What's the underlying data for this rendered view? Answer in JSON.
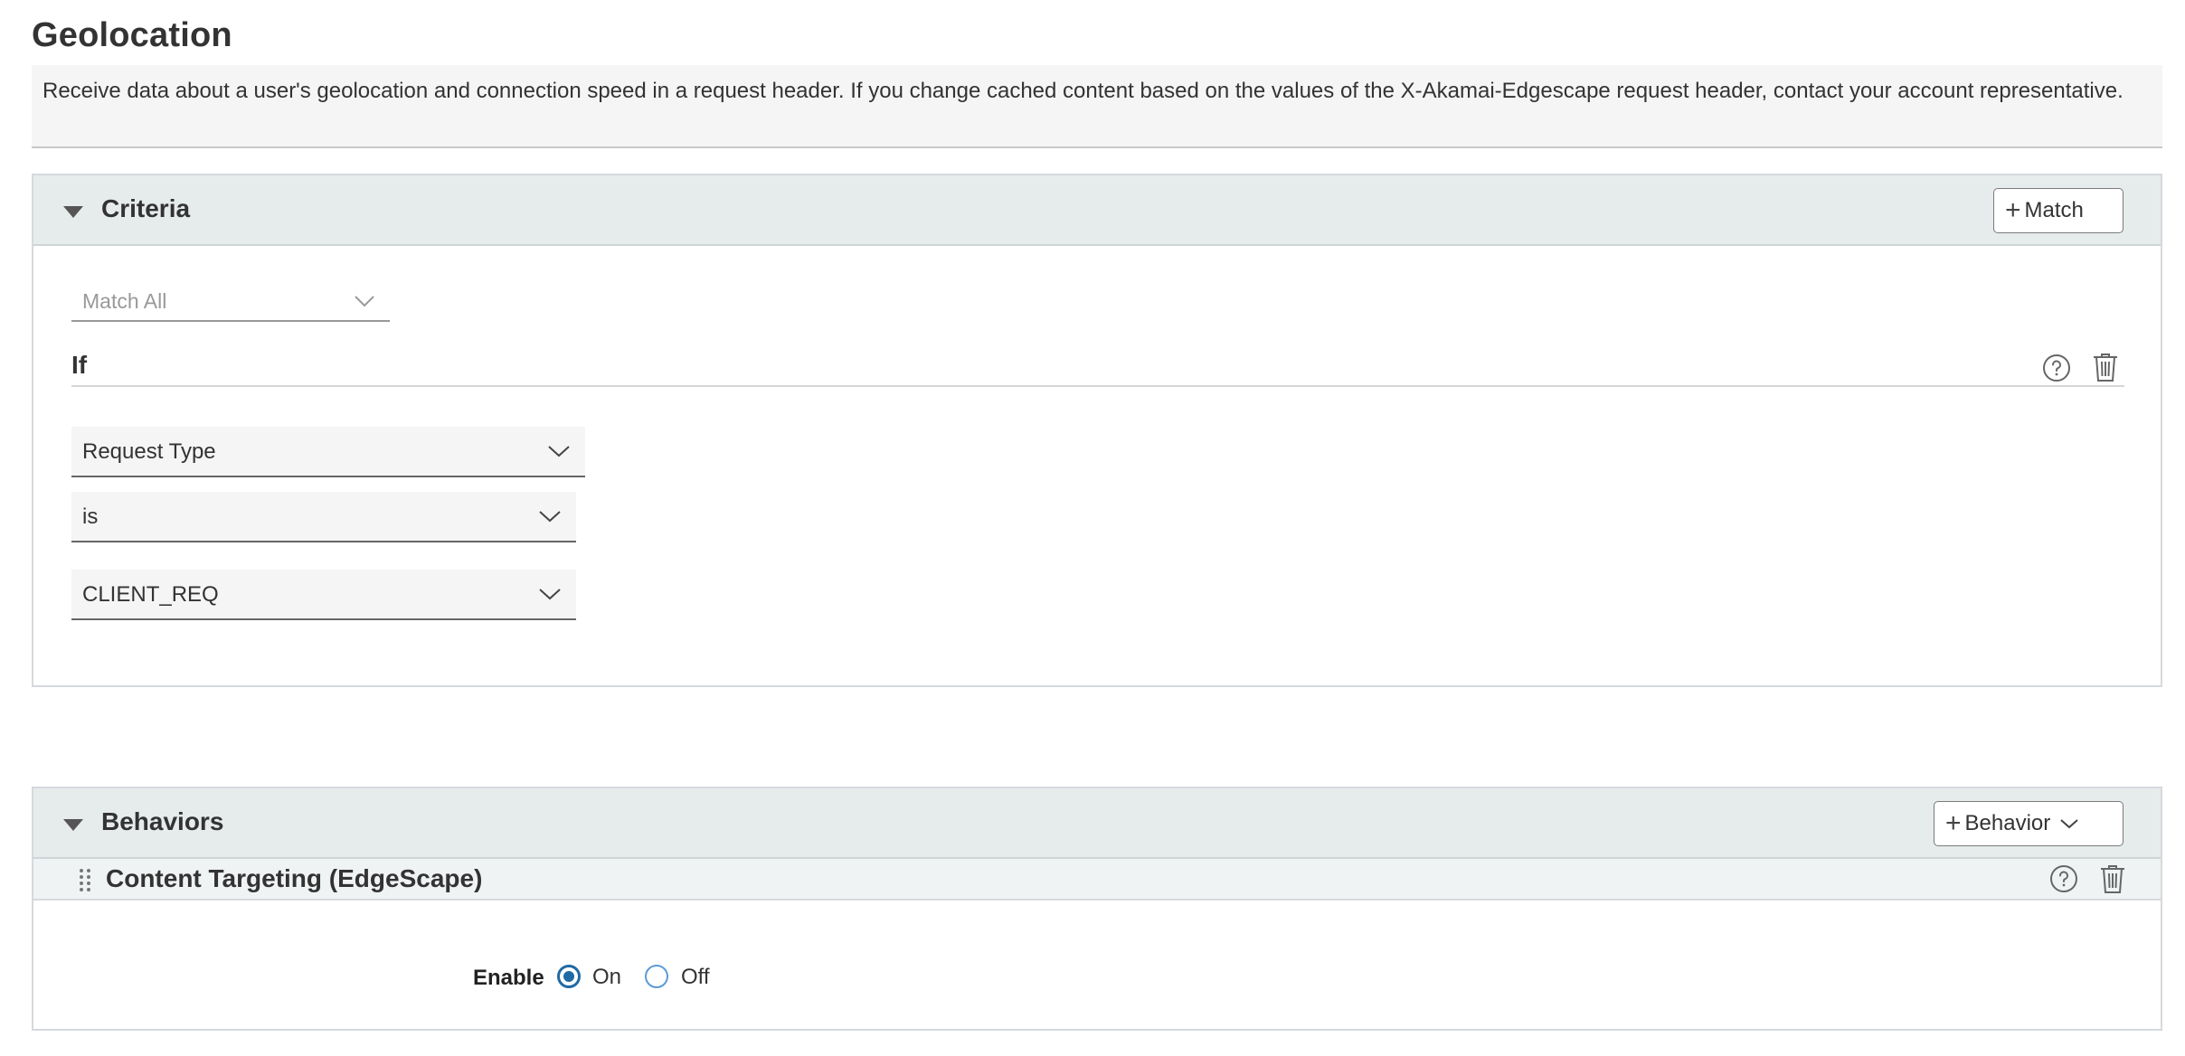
{
  "page": {
    "title": "Geolocation",
    "description": "Receive data about a user's geolocation and connection speed in a request header. If you change cached content based on the values of the X-Akamai-Edgescape request header, contact your account representative."
  },
  "criteria": {
    "title": "Criteria",
    "match_button": "Match",
    "match_mode": "Match All",
    "if_label": "If",
    "condition": {
      "field": "Request Type",
      "operator": "is",
      "value": "CLIENT_REQ"
    }
  },
  "behaviors": {
    "title": "Behaviors",
    "add_button": "Behavior",
    "items": [
      {
        "name": "Content Targeting (EdgeScape)",
        "enable_label": "Enable",
        "options": [
          "On",
          "Off"
        ],
        "selected": "On"
      }
    ]
  },
  "icons": {
    "help": "help-circle-icon",
    "delete": "trash-icon",
    "collapse": "caret-down-icon",
    "dropdown": "chevron-down-icon",
    "drag": "drag-handle-icon"
  },
  "colors": {
    "header_bg": "#e6ebec",
    "radio_accent": "#1f6aa5"
  }
}
